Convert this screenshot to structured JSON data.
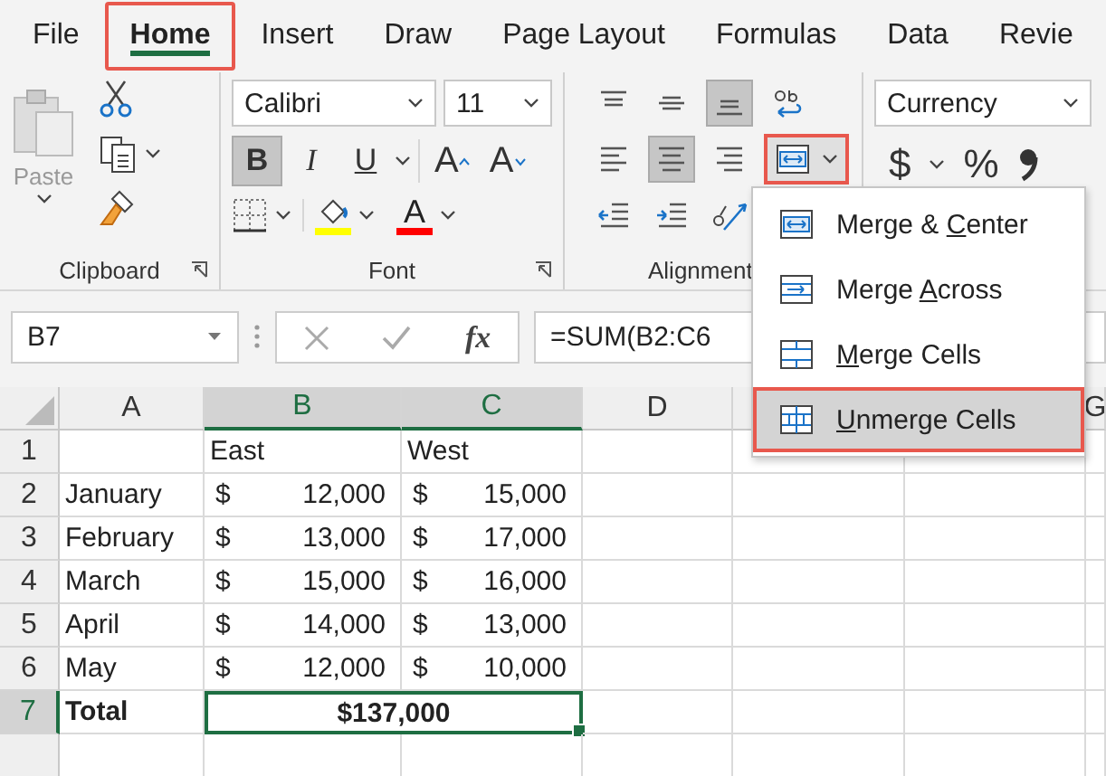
{
  "tabs": [
    {
      "label": "File",
      "selected": false,
      "highlighted": false
    },
    {
      "label": "Home",
      "selected": true,
      "highlighted": true
    },
    {
      "label": "Insert",
      "selected": false,
      "highlighted": false
    },
    {
      "label": "Draw",
      "selected": false,
      "highlighted": false
    },
    {
      "label": "Page Layout",
      "selected": false,
      "highlighted": false
    },
    {
      "label": "Formulas",
      "selected": false,
      "highlighted": false
    },
    {
      "label": "Data",
      "selected": false,
      "highlighted": false
    },
    {
      "label": "Revie",
      "selected": false,
      "highlighted": false
    }
  ],
  "clipboard": {
    "paste_label": "Paste",
    "group_label": "Clipboard"
  },
  "font": {
    "font_name": "Calibri",
    "font_size": "11",
    "styles": [
      {
        "label": "B",
        "kind": "bold",
        "selected": true
      },
      {
        "label": "I",
        "kind": "italic",
        "selected": false
      },
      {
        "label": "U",
        "kind": "underline",
        "selected": false
      }
    ],
    "grow_label": "A",
    "shrink_label": "A",
    "font_color_label": "A",
    "group_label": "Font"
  },
  "alignment": {
    "rows": [
      [
        {
          "kind": "align-top",
          "selected": false
        },
        {
          "kind": "align-middle",
          "selected": false
        },
        {
          "kind": "align-bottom",
          "selected": true
        },
        {
          "kind": "wrap",
          "selected": false
        }
      ],
      [
        {
          "kind": "align-left",
          "selected": false
        },
        {
          "kind": "align-center",
          "selected": true
        },
        {
          "kind": "align-right",
          "selected": false
        },
        {
          "kind": "merge",
          "highlighted": true
        }
      ],
      [
        {
          "kind": "indent-decrease",
          "selected": false
        },
        {
          "kind": "indent-increase",
          "selected": false
        },
        {
          "kind": "orientation",
          "selected": false
        }
      ]
    ],
    "group_label": "Alignment"
  },
  "number": {
    "format": "Currency",
    "currency_symbol": "$",
    "percent": "%"
  },
  "name_box": "B7",
  "function_label": "fx",
  "formula": "=SUM(B2:C6",
  "columns": [
    {
      "kind": "label",
      "label": "A",
      "selected": false
    },
    {
      "kind": "label",
      "label": "B",
      "selected": true
    },
    {
      "kind": "label",
      "label": "C",
      "selected": true
    },
    {
      "kind": "label",
      "label": "D",
      "selected": false
    },
    {
      "kind": "blank"
    },
    {
      "kind": "covered"
    },
    {
      "kind": "label",
      "label": "G",
      "selected": false
    }
  ],
  "rows": [
    {
      "header": "1",
      "selected": false,
      "cells": [
        {
          "kind": "empty"
        },
        {
          "kind": "text",
          "text": "East",
          "bold": false
        },
        {
          "kind": "text",
          "text": "West",
          "bold": false
        }
      ]
    },
    {
      "header": "2",
      "selected": false,
      "cells": [
        {
          "kind": "text",
          "text": "January",
          "bold": false
        },
        {
          "kind": "currency",
          "symbol": "$",
          "amount": "12,000"
        },
        {
          "kind": "currency",
          "symbol": "$",
          "amount": "15,000"
        }
      ]
    },
    {
      "header": "3",
      "selected": false,
      "cells": [
        {
          "kind": "text",
          "text": "February",
          "bold": false
        },
        {
          "kind": "currency",
          "symbol": "$",
          "amount": "13,000"
        },
        {
          "kind": "currency",
          "symbol": "$",
          "amount": "17,000"
        }
      ]
    },
    {
      "header": "4",
      "selected": false,
      "cells": [
        {
          "kind": "text",
          "text": "March",
          "bold": false
        },
        {
          "kind": "currency",
          "symbol": "$",
          "amount": "15,000"
        },
        {
          "kind": "currency",
          "symbol": "$",
          "amount": "16,000"
        }
      ]
    },
    {
      "header": "5",
      "selected": false,
      "cells": [
        {
          "kind": "text",
          "text": "April",
          "bold": false
        },
        {
          "kind": "currency",
          "symbol": "$",
          "amount": "14,000"
        },
        {
          "kind": "currency",
          "symbol": "$",
          "amount": "13,000"
        }
      ]
    },
    {
      "header": "6",
      "selected": false,
      "cells": [
        {
          "kind": "text",
          "text": "May",
          "bold": false
        },
        {
          "kind": "currency",
          "symbol": "$",
          "amount": "12,000"
        },
        {
          "kind": "currency",
          "symbol": "$",
          "amount": "10,000"
        }
      ]
    },
    {
      "header": "7",
      "selected": true,
      "cells": [
        {
          "kind": "text",
          "text": "Total",
          "bold": true
        },
        {
          "kind": "merged",
          "text": "$137,000",
          "bold": true,
          "selected": true
        }
      ]
    }
  ],
  "merge_menu": {
    "items": [
      {
        "kind": "merge-center",
        "before": "Merge & ",
        "key": "C",
        "after": "enter",
        "selected": false,
        "highlighted": false
      },
      {
        "kind": "merge-across",
        "before": "Merge ",
        "key": "A",
        "after": "cross",
        "selected": false,
        "highlighted": false
      },
      {
        "kind": "merge-cells",
        "key": "M",
        "after": "erge Cells",
        "selected": false,
        "highlighted": false
      },
      {
        "kind": "unmerge",
        "key": "U",
        "after": "nmerge Cells",
        "selected": true,
        "highlighted": true
      }
    ]
  }
}
